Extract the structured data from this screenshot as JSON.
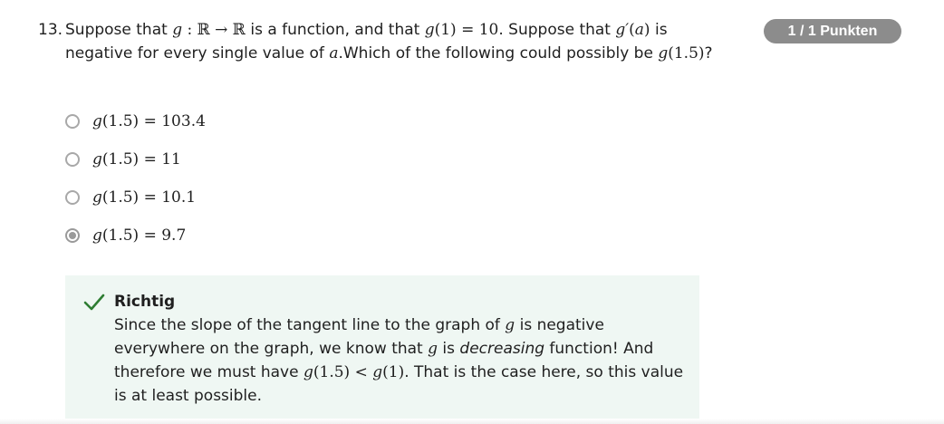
{
  "question": {
    "number": "13.",
    "text_parts": {
      "p1": "Suppose that ",
      "m1": "g",
      "m2": " : ℝ → ℝ",
      "p2": " is a function, and that ",
      "m3": "g",
      "m4": "(1) = 10",
      "p3": ". Suppose that ",
      "m5": "g′",
      "m6": "(",
      "m7": "a",
      "m8": ")",
      "p4": " is negative for every single value of ",
      "m9": "a",
      "p5": ".Which of the following could possibly be ",
      "m10": "g",
      "m11": "(1.5)",
      "p6": "?"
    }
  },
  "score_badge": "1 / 1 Punkten",
  "options": [
    {
      "fn": "g",
      "rest": "(1.5) = 103.4",
      "selected": false
    },
    {
      "fn": "g",
      "rest": "(1.5) = 11",
      "selected": false
    },
    {
      "fn": "g",
      "rest": "(1.5) = 10.1",
      "selected": false
    },
    {
      "fn": "g",
      "rest": "(1.5) = 9.7",
      "selected": true
    }
  ],
  "feedback": {
    "title": "Richtig",
    "status_color": "#2e7d32",
    "body_parts": {
      "p1": "Since the slope of the tangent line to the graph of ",
      "m1": "g",
      "p2": " is negative everywhere on the graph, we know that ",
      "m2": "g",
      "p3": " is ",
      "em1": "decreasing",
      "p4": " function! And therefore we must have ",
      "m3": "g",
      "m4": "(1.5) < ",
      "m5": "g",
      "m6": "(1)",
      "p5": ". That is the case here, so this value is at least possible."
    }
  },
  "icons": {
    "feedback_status": "checkmark-icon",
    "option_selected": "radio-selected-icon",
    "option_unselected": "radio-unselected-icon"
  }
}
